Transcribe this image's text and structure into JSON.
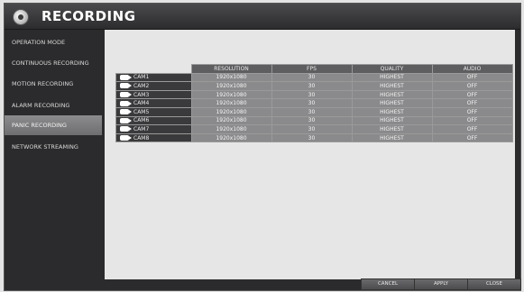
{
  "app": {
    "title": "RECORDING",
    "icon": "film-reel-icon"
  },
  "sidebar": {
    "items": [
      {
        "label": "OPERATION MODE",
        "active": false
      },
      {
        "label": "CONTINUOUS RECORDING",
        "active": false
      },
      {
        "label": "MOTION RECORDING",
        "active": false
      },
      {
        "label": "ALARM RECORDING",
        "active": false
      },
      {
        "label": "PANIC RECORDING",
        "active": true
      },
      {
        "label": "NETWORK STREAMING",
        "active": false
      }
    ]
  },
  "table": {
    "headers": {
      "resolution": "RESOLUTION",
      "fps": "FPS",
      "quality": "QUALITY",
      "audio": "AUDIO"
    },
    "rows": [
      {
        "cam": "CAM1",
        "resolution": "1920x1080",
        "fps": "30",
        "quality": "HIGHEST",
        "audio": "OFF"
      },
      {
        "cam": "CAM2",
        "resolution": "1920x1080",
        "fps": "30",
        "quality": "HIGHEST",
        "audio": "OFF"
      },
      {
        "cam": "CAM3",
        "resolution": "1920x1080",
        "fps": "30",
        "quality": "HIGHEST",
        "audio": "OFF"
      },
      {
        "cam": "CAM4",
        "resolution": "1920x1080",
        "fps": "30",
        "quality": "HIGHEST",
        "audio": "OFF"
      },
      {
        "cam": "CAM5",
        "resolution": "1920x1080",
        "fps": "30",
        "quality": "HIGHEST",
        "audio": "OFF"
      },
      {
        "cam": "CAM6",
        "resolution": "1920x1080",
        "fps": "30",
        "quality": "HIGHEST",
        "audio": "OFF"
      },
      {
        "cam": "CAM7",
        "resolution": "1920x1080",
        "fps": "30",
        "quality": "HIGHEST",
        "audio": "OFF"
      },
      {
        "cam": "CAM8",
        "resolution": "1920x1080",
        "fps": "30",
        "quality": "HIGHEST",
        "audio": "OFF"
      }
    ]
  },
  "buttons": {
    "cancel": "CANCEL",
    "apply": "APPLY",
    "close": "CLOSE"
  }
}
